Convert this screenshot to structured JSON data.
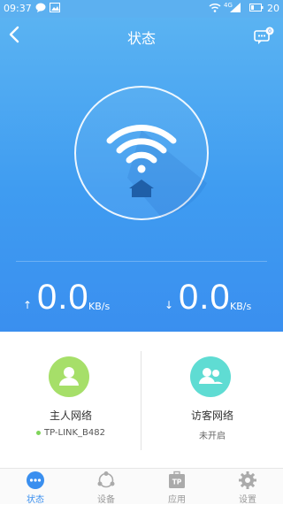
{
  "status_bar": {
    "time": "09:37",
    "signal": "4G",
    "battery": "20"
  },
  "header": {
    "title": "状态",
    "back_icon": "back-arrow-icon",
    "message_icon": "message-icon",
    "message_badge": "0"
  },
  "speed": {
    "upload": {
      "value": "0.0",
      "unit": "KB/s",
      "arrow": "↑"
    },
    "download": {
      "value": "0.0",
      "unit": "KB/s",
      "arrow": "↓"
    }
  },
  "networks": {
    "host": {
      "title": "主人网络",
      "ssid": "TP-LINK_B482",
      "icon": "user-icon",
      "color": "#a6df69"
    },
    "guest": {
      "title": "访客网络",
      "status": "未开启",
      "icon": "users-icon",
      "color": "#5fdcd3"
    }
  },
  "nav": {
    "items": [
      {
        "label": "状态",
        "icon": "status-dots-icon"
      },
      {
        "label": "设备",
        "icon": "devices-icon"
      },
      {
        "label": "应用",
        "icon": "apps-tp-icon"
      },
      {
        "label": "设置",
        "icon": "gear-icon"
      }
    ]
  },
  "colors": {
    "accent": "#3a8fef",
    "hero_top": "#5ab3f2",
    "hero_bottom": "#3a8fef",
    "house": "#1f5fa8"
  }
}
